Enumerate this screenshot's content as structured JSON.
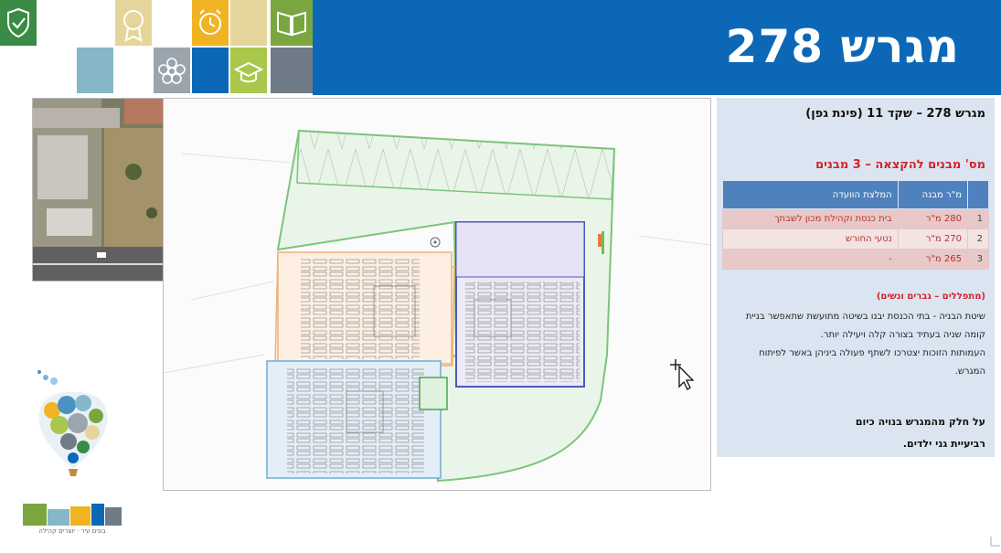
{
  "header": {
    "title": "מגרש 278",
    "bg_color": "#0c68b6"
  },
  "tiles": {
    "icons": [
      "shield-check-icon",
      "medal-icon",
      "alarm-clock-icon",
      "open-book-icon",
      "flower-icon",
      "graduation-cap-icon"
    ]
  },
  "panel": {
    "heading": "מגרש 278 – שקד 11 (פינת גפן)",
    "building_count": "מס' מבנים להקצאה – 3 מבנים",
    "table": {
      "columns": [
        "מ\"ר מבנה",
        "המלצת הוועדה"
      ],
      "rows": [
        {
          "n": "1",
          "area": "280 מ\"ר",
          "rec": "בית כנסת וקהילת מכון לשבתך"
        },
        {
          "n": "2",
          "area": "270 מ\"ר",
          "rec": "נטעי החורש"
        },
        {
          "n": "3",
          "area": "265 מ\"ר",
          "rec": "-"
        }
      ]
    },
    "worshippers": "(מתפללים – גברים ונשים)",
    "method": "שיטת הבניה - בתי הכנסת יבנו בשיטה מתועשת שתאפשר בניית קומה שניה בעתיד בצורה קלה ויעילה יותר.",
    "associations": "העמותות הזוכות יצטרכו לשתף פעולה ביניהן באשר לפיתוח המגרש.",
    "partial_line1": "על חלק מהמגרש בנויה כיום",
    "partial_line2": "רביעיית גני ילדים.",
    "accent_color": "#d2232a",
    "table_header_color": "#4f81bd"
  },
  "logo": {
    "caption": "בונים עיר · יוצרים קהילה"
  }
}
